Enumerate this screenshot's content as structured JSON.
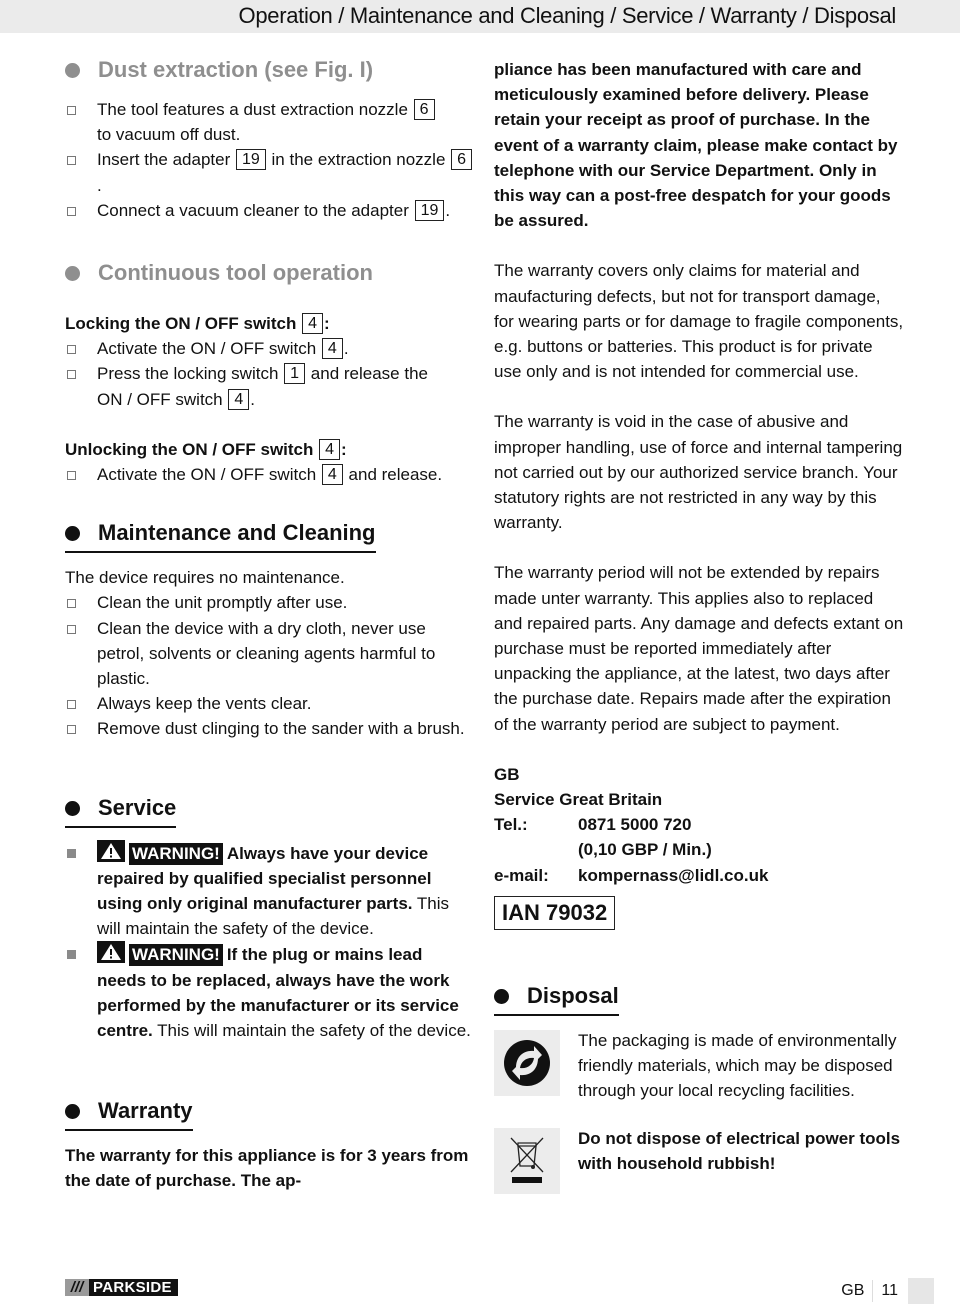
{
  "header": {
    "title": "Operation / Maintenance and Cleaning / Service / Warranty / Disposal"
  },
  "dust": {
    "heading": "Dust extraction (see Fig. I)",
    "items": [
      {
        "pre": "The tool features a dust extraction nozzle",
        "ref": "6",
        "post": "",
        "line2": "to vacuum off dust."
      },
      {
        "pre": "Insert the adapter",
        "ref": "19",
        "mid": "in the extraction nozzle",
        "ref2": "6",
        "post": "."
      },
      {
        "pre": "Connect a vacuum cleaner to the adapter",
        "ref": "19",
        "post": "."
      }
    ]
  },
  "continuous": {
    "heading": "Continuous tool operation",
    "locking": {
      "title": "Locking the ON / OFF switch",
      "ref": "4",
      "colon": ":",
      "items": [
        {
          "pre": "Activate the ON / OFF switch",
          "ref": "4",
          "post": "."
        },
        {
          "pre": "Press the locking switch",
          "ref": "1",
          "mid": "and release the",
          "line2": "ON / OFF switch",
          "ref2": "4",
          "post": "."
        }
      ]
    },
    "unlocking": {
      "title": "Unlocking the ON / OFF switch",
      "ref": "4",
      "colon": ":",
      "items": [
        {
          "pre": "Activate the ON / OFF switch",
          "ref": "4",
          "post": "and release."
        }
      ]
    }
  },
  "maintenance": {
    "heading": "Maintenance and Cleaning",
    "intro": "The device requires no maintenance.",
    "items": [
      "Clean the unit promptly after use.",
      "Clean the device with a dry cloth, never use petrol, solvents or cleaning agents harmful to plastic.",
      "Always keep the vents clear.",
      "Remove dust clinging to the sander with a brush."
    ]
  },
  "service": {
    "heading": "Service",
    "warning_label": "WARNING!",
    "items": [
      {
        "bold": "Always have your device repaired by qualified specialist personnel using only original manufacturer parts.",
        "normal": "This will maintain the safety of the device."
      },
      {
        "bold": "If the plug or mains lead needs to be replaced, always have the work performed by the manufacturer or its service centre.",
        "normal": "This will maintain the safety of the device."
      }
    ]
  },
  "warranty": {
    "heading": "Warranty",
    "intro_bold": "The warranty for this appliance is for 3 years from the date of purchase. The ap-",
    "cont_bold": "pliance has been manufactured with care and meticulously examined before delivery. Please retain your receipt as proof of purchase. In the event of a warranty claim, please make contact by telephone with our Service Department. Only in this way can a post-free despatch for your goods be assured.",
    "paragraphs": [
      "The warranty covers only claims for material and maufacturing defects, but not for transport damage, for wearing parts or for damage to fragile components, e.g. buttons or batteries. This product is for private use only and is not intended for commercial use.",
      "The warranty is void in the case of abusive and improper handling, use of force and internal tampering not carried out by our authorized service branch. Your statutory rights are not restricted in any way by this warranty.",
      "The warranty period will not be extended by repairs made unter warranty. This applies also to replaced and repaired parts. Any damage and defects extant on purchase must be reported immediately after unpacking the appliance, at the latest, two days after the purchase date. Repairs made after the expiration of the warranty period are subject to payment."
    ]
  },
  "contact": {
    "country": "GB",
    "service_name": "Service Great Britain",
    "tel_label": "Tel.:",
    "tel": "0871 5000 720",
    "rate": "(0,10 GBP / Min.)",
    "email_label": "e-mail:",
    "email": "kompernass@lidl.co.uk",
    "ian": "IAN 79032"
  },
  "disposal": {
    "heading": "Disposal",
    "packaging_text": "The packaging is made of environmentally friendly materials, which may be disposed through your local recycling facilities.",
    "weee_text": "Do not dispose of electrical power tools with household rubbish!",
    "packaging_icon": "green-dot-recycling-icon",
    "weee_icon": "crossed-out-wheelie-bin-icon"
  },
  "footer": {
    "brand_slashes": "///",
    "brand_name": "PARKSIDE",
    "lang": "GB",
    "page": "11"
  }
}
